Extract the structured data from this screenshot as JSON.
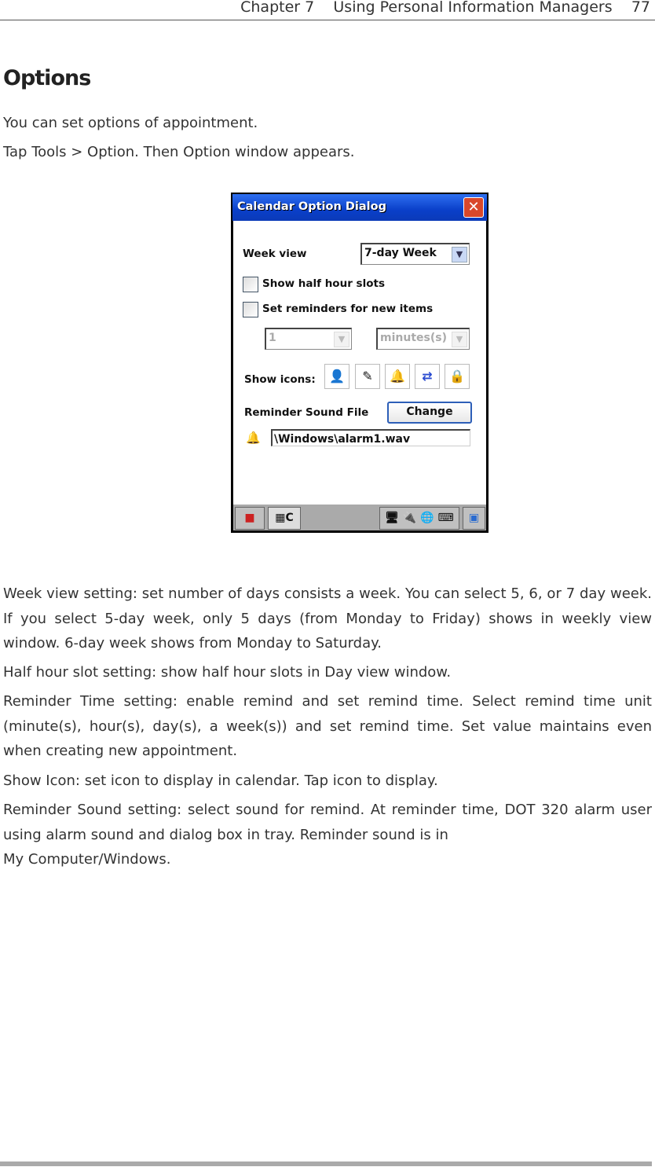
{
  "header": {
    "chapter": "Chapter 7",
    "title": "Using Personal Information Managers",
    "page": "77"
  },
  "heading": "Options",
  "intro": [
    "You can set options of appointment.",
    "Tap Tools > Option. Then Option window appears."
  ],
  "dialog": {
    "title": "Calendar Option Dialog",
    "close": "✕",
    "week_view_label": "Week view",
    "week_view_value": "7-day Week",
    "half_hour": "Show half hour slots",
    "half_hour_checked": false,
    "reminders": "Set reminders for new items",
    "reminders_checked": false,
    "reminder_amount": "1",
    "reminder_unit": "minutes(s)",
    "show_icons_label": "Show icons:",
    "icons": [
      "person-icon",
      "pencil-icon",
      "bell-icon",
      "recurrence-icon",
      "lock-icon"
    ],
    "sound_label": "Reminder Sound File",
    "change_button": "Change",
    "sound_file": "\\Windows\\alarm1.wav",
    "taskbar_app": "C"
  },
  "body": [
    "Week view setting: set number of days consists a week. You can select 5, 6, or 7 day week. If you select 5-day week, only 5 days (from Monday to Friday) shows in weekly view window. 6-day week shows from Monday to Saturday.",
    "Half hour slot setting: show half hour slots in Day view window.",
    "Reminder Time setting: enable remind and set remind time. Select remind time unit (minute(s), hour(s), day(s), a week(s)) and set remind time. Set value maintains even when creating new appointment.",
    "Show Icon: set icon to display in calendar. Tap icon to display.",
    "Reminder Sound setting: select sound for remind. At reminder time, DOT 320 alarm user using alarm sound and dialog box in tray. Reminder sound is in",
    "My Computer/Windows."
  ]
}
